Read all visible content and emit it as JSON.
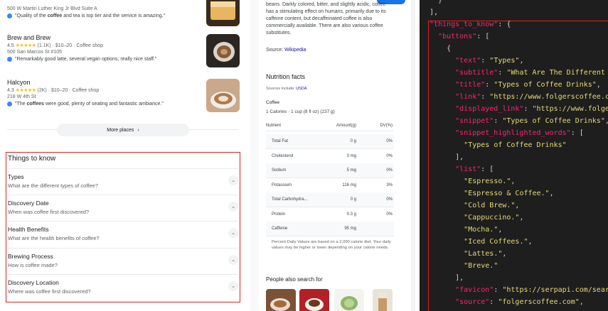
{
  "places": [
    {
      "name": "",
      "rating": "",
      "reviews": "",
      "price": "",
      "category": "",
      "address": "500 W Martin Luther King Jr Blvd Suite A",
      "review_pre": "\"Quality of the ",
      "review_bold": "coffee",
      "review_post": " and tea is top tier and the service is amazing.\""
    },
    {
      "name": "Brew and Brew",
      "rating": "4.5",
      "stars": "★★★★★",
      "reviews": "(1.1K)",
      "price": "$10–20",
      "category": "Coffee shop",
      "address": "500 San Marcos St #105",
      "review_pre": "\"Remarkably good latte, several vegan options, really nice staff.\"",
      "review_bold": "",
      "review_post": ""
    },
    {
      "name": "Halcyon",
      "rating": "4.3",
      "stars": "★★★★★",
      "reviews": "(2K)",
      "price": "$10–20",
      "category": "Coffee shop",
      "address": "218 W 4th St",
      "review_pre": "\"The ",
      "review_bold": "coffees",
      "review_post": " were good, plenty of seating and fantastic ambiance.\""
    }
  ],
  "more_places": {
    "label": "More places",
    "chevron": "›"
  },
  "things_to_know": {
    "title": "Things to know",
    "items": [
      {
        "heading": "Types",
        "sub": "What are the different types of coffee?"
      },
      {
        "heading": "Discovery Date",
        "sub": "When was coffee first discovered?"
      },
      {
        "heading": "Health Benefits",
        "sub": "What are the health benefits of coffee?"
      },
      {
        "heading": "Brewing Process",
        "sub": "How is coffee made?"
      },
      {
        "heading": "Discovery Location",
        "sub": "Where was coffee first discovered?"
      }
    ],
    "chevron": "⌄"
  },
  "description": "beans. Darkly colored, bitter, and slightly acidic, coffee has a stimulating effect on humans, primarily due to its caffeine content, but decaffeinated coffee is also commercially available. There are also various coffee substitutes.",
  "source": {
    "label": "Source:",
    "link": "Wikipedia"
  },
  "nutrition": {
    "title": "Nutrition facts",
    "sources_label": "Sources include:",
    "sources_link": "USDA",
    "food": "Coffee",
    "serving": "1 Calories · 1 cup (8 fl oz) (237 g)",
    "headers": {
      "nutrient": "Nutrient",
      "amount": "Amount(g)",
      "dv": "DV(%)"
    },
    "rows": [
      {
        "n": "Total Fat",
        "a": "0 g",
        "d": "0%"
      },
      {
        "n": "Cholesterol",
        "a": "0 mg",
        "d": "0%"
      },
      {
        "n": "Sodium",
        "a": "5 mg",
        "d": "0%"
      },
      {
        "n": "Potassium",
        "a": "116 mg",
        "d": "3%"
      },
      {
        "n": "Total Carbohydra...",
        "a": "0 g",
        "d": "0%"
      },
      {
        "n": "Protein",
        "a": "0.3 g",
        "d": "0%"
      },
      {
        "n": "Caffeine",
        "a": "95 mg",
        "d": ""
      }
    ],
    "note": "Percent Daily Values are based on a 2,000 calorie diet. Your daily values may be higher or lower depending on your calorie needs."
  },
  "people_also_search": {
    "title": "People also search for"
  },
  "code": {
    "lines": [
      {
        "indent": "  ",
        "parts": [
          {
            "t": "p",
            "v": "}"
          }
        ]
      },
      {
        "indent": "",
        "parts": [
          {
            "t": "p",
            "v": "],"
          }
        ]
      },
      {
        "indent": "",
        "parts": [
          {
            "t": "k",
            "v": "\"things_to_know\""
          },
          {
            "t": "p",
            "v": ": {"
          }
        ]
      },
      {
        "indent": "  ",
        "parts": [
          {
            "t": "k",
            "v": "\"buttons\""
          },
          {
            "t": "p",
            "v": ": ["
          }
        ]
      },
      {
        "indent": "    ",
        "parts": [
          {
            "t": "p",
            "v": "{"
          }
        ]
      },
      {
        "indent": "      ",
        "parts": [
          {
            "t": "k",
            "v": "\"text\""
          },
          {
            "t": "p",
            "v": ": "
          },
          {
            "t": "s",
            "v": "\"Types\""
          },
          {
            "t": "p",
            "v": ","
          }
        ]
      },
      {
        "indent": "      ",
        "parts": [
          {
            "t": "k",
            "v": "\"subtitle\""
          },
          {
            "t": "p",
            "v": ": "
          },
          {
            "t": "s",
            "v": "\"What Are The Different"
          }
        ]
      },
      {
        "indent": "      ",
        "parts": [
          {
            "t": "k",
            "v": "\"title\""
          },
          {
            "t": "p",
            "v": ": "
          },
          {
            "t": "s",
            "v": "\"Types of Coffee Drinks\""
          },
          {
            "t": "p",
            "v": ","
          }
        ]
      },
      {
        "indent": "      ",
        "parts": [
          {
            "t": "k",
            "v": "\"link\""
          },
          {
            "t": "p",
            "v": ": "
          },
          {
            "t": "s",
            "v": "\"https://www.folgerscoffee.c"
          }
        ]
      },
      {
        "indent": "      ",
        "parts": [
          {
            "t": "k",
            "v": "\"displayed_link\""
          },
          {
            "t": "p",
            "v": ": "
          },
          {
            "t": "s",
            "v": "\"https://www.folge"
          }
        ]
      },
      {
        "indent": "      ",
        "parts": [
          {
            "t": "k",
            "v": "\"snippet\""
          },
          {
            "t": "p",
            "v": ": "
          },
          {
            "t": "s",
            "v": "\"Types of Coffee Drinks\""
          },
          {
            "t": "p",
            "v": ","
          }
        ]
      },
      {
        "indent": "      ",
        "parts": [
          {
            "t": "k",
            "v": "\"snippet_highlighted_words\""
          },
          {
            "t": "p",
            "v": ": ["
          }
        ]
      },
      {
        "indent": "        ",
        "parts": [
          {
            "t": "s",
            "v": "\"Types of Coffee Drinks\""
          }
        ]
      },
      {
        "indent": "      ",
        "parts": [
          {
            "t": "p",
            "v": "],"
          }
        ]
      },
      {
        "indent": "      ",
        "parts": [
          {
            "t": "k",
            "v": "\"list\""
          },
          {
            "t": "p",
            "v": ": ["
          }
        ]
      },
      {
        "indent": "        ",
        "parts": [
          {
            "t": "s",
            "v": "\"Espresso.\""
          },
          {
            "t": "p",
            "v": ","
          }
        ]
      },
      {
        "indent": "        ",
        "parts": [
          {
            "t": "s",
            "v": "\"Espresso & Coffee.\""
          },
          {
            "t": "p",
            "v": ","
          }
        ]
      },
      {
        "indent": "        ",
        "parts": [
          {
            "t": "s",
            "v": "\"Cold Brew.\""
          },
          {
            "t": "p",
            "v": ","
          }
        ]
      },
      {
        "indent": "        ",
        "parts": [
          {
            "t": "s",
            "v": "\"Cappuccino.\""
          },
          {
            "t": "p",
            "v": ","
          }
        ]
      },
      {
        "indent": "        ",
        "parts": [
          {
            "t": "s",
            "v": "\"Mocha.\""
          },
          {
            "t": "p",
            "v": ","
          }
        ]
      },
      {
        "indent": "        ",
        "parts": [
          {
            "t": "s",
            "v": "\"Iced Coffees.\""
          },
          {
            "t": "p",
            "v": ","
          }
        ]
      },
      {
        "indent": "        ",
        "parts": [
          {
            "t": "s",
            "v": "\"Lattes.\""
          },
          {
            "t": "p",
            "v": ","
          }
        ]
      },
      {
        "indent": "        ",
        "parts": [
          {
            "t": "s",
            "v": "\"Breve.\""
          }
        ]
      },
      {
        "indent": "      ",
        "parts": [
          {
            "t": "p",
            "v": "],"
          }
        ]
      },
      {
        "indent": "      ",
        "parts": [
          {
            "t": "k",
            "v": "\"favicon\""
          },
          {
            "t": "p",
            "v": ": "
          },
          {
            "t": "s",
            "v": "\"https://serpapi.com/sear"
          }
        ]
      },
      {
        "indent": "      ",
        "parts": [
          {
            "t": "k",
            "v": "\"source\""
          },
          {
            "t": "p",
            "v": ": "
          },
          {
            "t": "s",
            "v": "\"folgerscoffee.com\""
          },
          {
            "t": "p",
            "v": ","
          }
        ]
      }
    ]
  },
  "colors": {
    "highlight_border": "#e02020",
    "link": "#1a0dab",
    "star": "#fbbc04",
    "code_bg": "#1e1e1e",
    "code_key": "#f92672",
    "code_string": "#e6db74"
  }
}
